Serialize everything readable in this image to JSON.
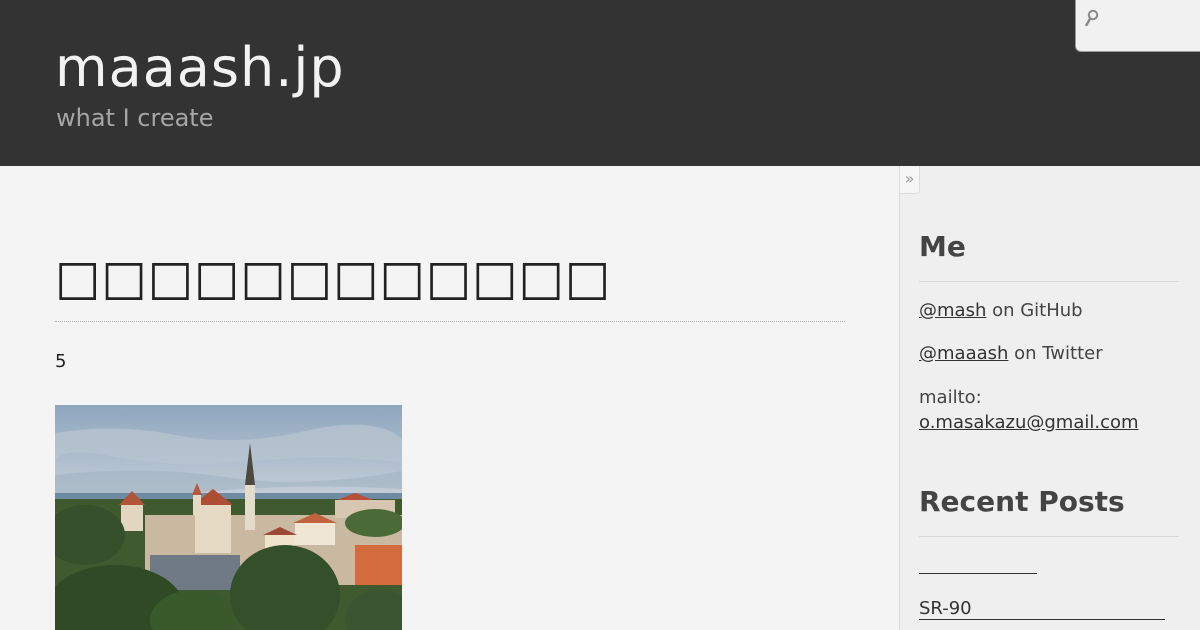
{
  "header": {
    "site_title": "maaash.jp",
    "site_subtitle": "what I create",
    "search_placeholder": ""
  },
  "post": {
    "title": "□□□□□□□□□□□□",
    "number": "5"
  },
  "sidebar": {
    "toggle_label": "»",
    "me_heading": "Me",
    "github_handle": "@mash",
    "github_suffix": " on GitHub",
    "twitter_handle": "@maaash",
    "twitter_suffix": " on Twitter",
    "mailto_label": "mailto:",
    "email": "o.masakazu@gmail.com",
    "recent_heading": "Recent Posts",
    "recent_posts": [
      "",
      "SR-90"
    ]
  },
  "colors": {
    "header_bg": "#333333",
    "content_bg": "#f4f4f4",
    "sidebar_bg": "#efefef"
  }
}
